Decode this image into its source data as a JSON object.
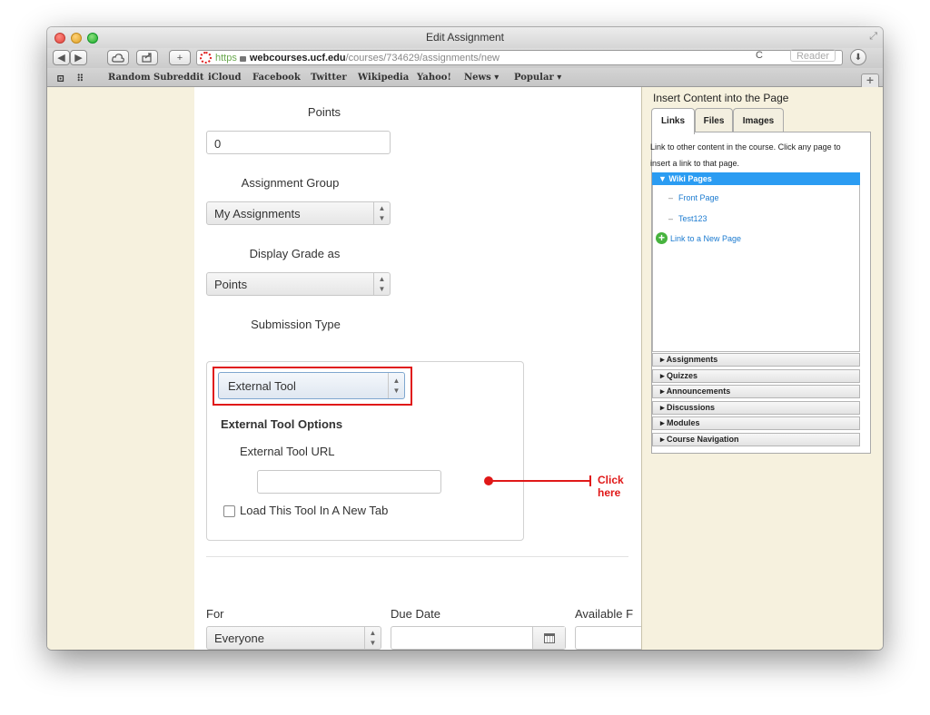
{
  "window": {
    "title": "Edit Assignment"
  },
  "toolbar": {
    "back_label": "◀",
    "forward_label": "▶",
    "new_tab_label": "+",
    "https_label": "https",
    "domain": "webcourses.ucf.edu",
    "path": "/courses/734629/assignments/new",
    "reload_label": "C",
    "reader_label": "Reader"
  },
  "bookmarks": {
    "items": [
      "Random Subreddit",
      "iCloud",
      "Facebook",
      "Twitter",
      "Wikipedia",
      "Yahoo!",
      "News ▾",
      "Popular ▾"
    ]
  },
  "form": {
    "points_label": "Points",
    "points_value": "0",
    "assignment_group_label": "Assignment Group",
    "assignment_group_value": "My Assignments",
    "display_grade_label": "Display Grade as",
    "display_grade_value": "Points",
    "submission_type_label": "Submission Type",
    "submission_type_value": "External Tool",
    "external_tool_options_title": "External Tool Options",
    "external_tool_url_label": "External Tool URL",
    "external_tool_url_value": "",
    "new_tab_checkbox_label": "Load This Tool In A New Tab",
    "for_label": "For",
    "for_value": "Everyone",
    "due_date_label": "Due Date",
    "due_date_value": "",
    "available_from_label": "Available F"
  },
  "annotation": {
    "text": "Click here",
    "color": "#e01818"
  },
  "sidebar": {
    "title": "Insert Content into the Page",
    "tabs": [
      "Links",
      "Files",
      "Images"
    ],
    "description": "Link to other content in the course. Click any page to insert a link to that page.",
    "wiki_header": "Wiki Pages",
    "wiki_items": [
      "Front Page",
      "Test123"
    ],
    "new_page_link": "Link to a New Page",
    "sections": [
      "Assignments",
      "Quizzes",
      "Announcements",
      "Discussions",
      "Modules",
      "Course Navigation"
    ]
  },
  "colors": {
    "accent_blue": "#2b9cf2",
    "link_blue": "#1c7bd0",
    "sidebar_bg": "#f6f1de"
  }
}
